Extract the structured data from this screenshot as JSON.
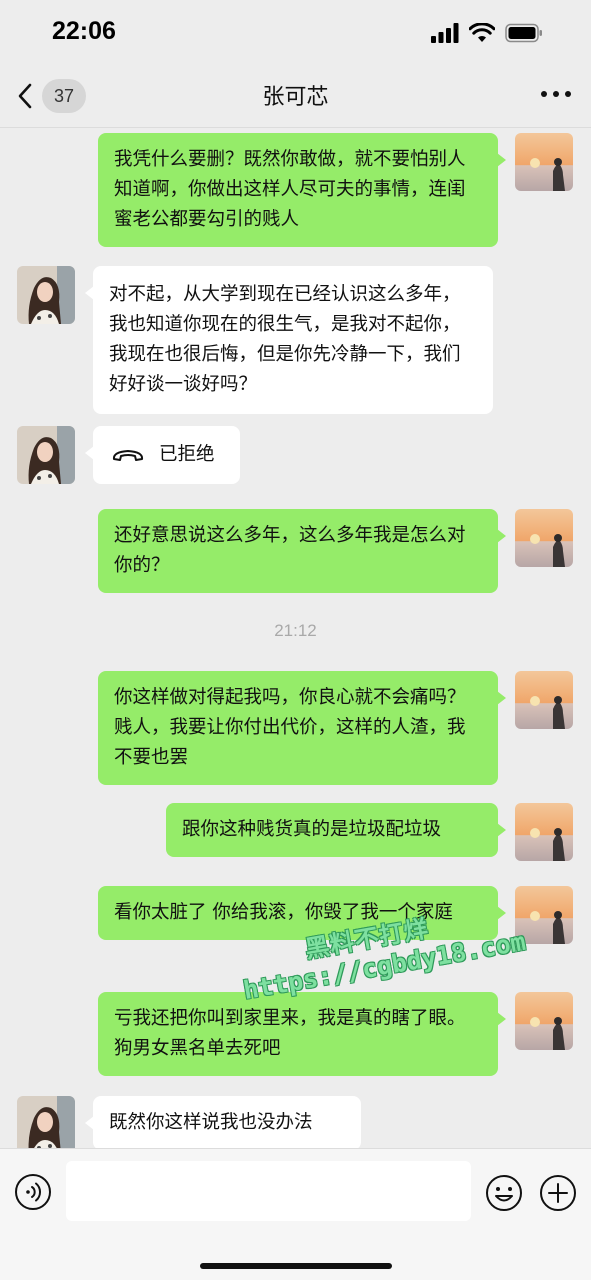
{
  "status_bar": {
    "time": "22:06"
  },
  "nav": {
    "back_count": "37",
    "title": "张可芯"
  },
  "messages": [
    {
      "side": "me",
      "text": "我凭什么要删？既然你敢做，就不要怕别人知道啊，你做出这样人尽可夫的事情，连闺蜜老公都要勾引的贱人"
    },
    {
      "side": "them",
      "text": "对不起，从大学到现在已经认识这么多年，我也知道你现在的很生气，是我对不起你，我现在也很后悔，但是你先冷静一下，我们好好谈一谈好吗？"
    },
    {
      "side": "them",
      "type": "call",
      "text": "已拒绝"
    },
    {
      "side": "me",
      "text": "还好意思说这么多年，这么多年我是怎么对你的？"
    },
    {
      "side": "me",
      "text": "你这样做对得起我吗，你良心就不会痛吗？贱人，我要让你付出代价，这样的人渣，我不要也罢"
    },
    {
      "side": "me",
      "text": "跟你这种贱货真的是垃圾配垃圾"
    },
    {
      "side": "me",
      "text": "看你太脏了 你给我滚，你毁了我一个家庭"
    },
    {
      "side": "me",
      "text": "亏我还把你叫到家里来，我是真的瞎了眼。狗男女黑名单去死吧"
    },
    {
      "side": "them",
      "text": "既然你这样说我也没办法"
    }
  ],
  "timestamp": "21:12",
  "watermark": {
    "line1": "黑料不打烊",
    "line2": "https://cgbdy18.com"
  },
  "icons": {
    "back": "chevron-left-icon",
    "more": "more-dots-icon",
    "call": "phone-hangup-icon",
    "voice": "voice-icon",
    "emoji": "emoji-icon",
    "plus": "plus-icon"
  },
  "colors": {
    "my_bubble": "#95ec69",
    "their_bubble": "#ffffff",
    "background": "#ededed"
  }
}
